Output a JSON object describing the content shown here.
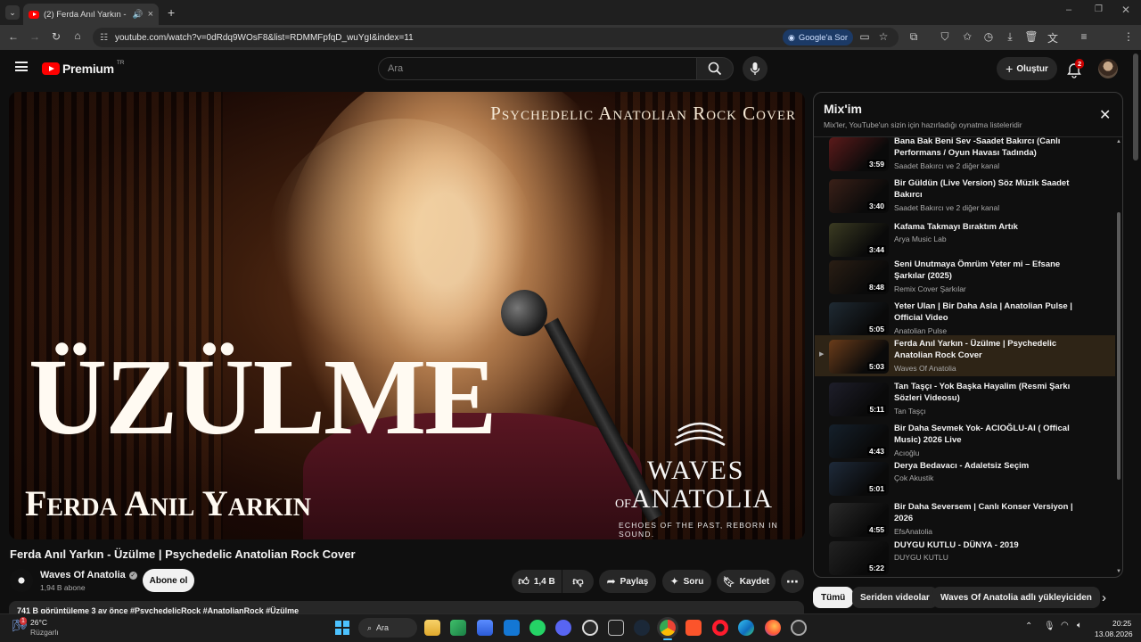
{
  "browser": {
    "tab_title": "(2) Ferda Anıl Yarkın - Üzülme",
    "url": "youtube.com/watch?v=0dRdq9WOsF8&list=RDMMFpfqD_wuYgI&index=11",
    "gemini_label": "Google'a Sor"
  },
  "header": {
    "logo_text": "Premium",
    "logo_region": "TR",
    "search_placeholder": "Ara",
    "create_label": "Oluştur",
    "notification_count": "2"
  },
  "video": {
    "top_text": "Psychedelic Anatolian Rock Cover",
    "big_title": "ÜZÜLME",
    "artist_text": "Ferda Anıl Yarkın",
    "brand_line1": "WAVES",
    "brand_line2_prefix": "OF",
    "brand_line2": "ANATOLIA",
    "brand_tagline": "ECHOES OF THE PAST, REBORN IN SOUND."
  },
  "meta": {
    "title": "Ferda Anıl Yarkın - Üzülme | Psychedelic Anatolian Rock Cover",
    "channel": "Waves Of Anatolia",
    "subscribers": "1,94 B abone",
    "subscribe_label": "Abone ol",
    "likes": "1,4 B",
    "share_label": "Paylaş",
    "ask_label": "Soru",
    "save_label": "Kaydet",
    "description_peek": "741 B görüntüleme  3 ay önce  #PsychedelicRock #AnatolianRock #Üzülme"
  },
  "mix": {
    "title": "Mix'im",
    "subtitle": "Mix'ler, YouTube'un sizin için hazırladığı oynatma listeleridir",
    "items": [
      {
        "title": "Bana Bak Beni Sev -Saadet Bakırcı (Canlı Performans / Oyun Havası Tadında)",
        "channel": "Saadet Bakırcı ve 2 diğer kanal",
        "duration": "3:59"
      },
      {
        "title": "Bir Güldün (Live Version) Söz Müzik Saadet Bakırcı",
        "channel": "Saadet Bakırcı ve 2 diğer kanal",
        "duration": "3:40"
      },
      {
        "title": "Kafama Takmayı Bıraktım Artık",
        "channel": "Arya Music Lab",
        "duration": "3:44"
      },
      {
        "title": "Seni Unutmaya Ömrüm Yeter mi – Efsane Şarkılar (2025)",
        "channel": "Remix Cover Şarkılar",
        "duration": "8:48"
      },
      {
        "title": "Yeter Ulan | Bir Daha Asla | Anatolian Pulse | Official Video",
        "channel": "Anatolian Pulse",
        "duration": "5:05"
      },
      {
        "title": "Ferda Anıl Yarkın - Üzülme | Psychedelic Anatolian Rock Cover",
        "channel": "Waves Of Anatolia",
        "duration": "5:03"
      },
      {
        "title": "Tan Taşçı - Yok Başka Hayalim (Resmi Şarkı Sözleri Videosu)",
        "channel": "Tan Taşçı",
        "duration": "5:11"
      },
      {
        "title": "Bir Daha Sevmek Yok- ACIOĞLU-AI ( Offical Music) 2026 Live",
        "channel": "Acıoğlu",
        "duration": "4:43"
      },
      {
        "title": "Derya Bedavacı - Adaletsiz Seçim",
        "channel": "Çok Akustik",
        "duration": "5:01"
      },
      {
        "title": "Bir Daha Seversem | Canlı Konser Versiyon | 2026",
        "channel": "EfsAnatolia",
        "duration": "4:55"
      },
      {
        "title": "DUYGU KUTLU - DÜNYA - 2019",
        "channel": "DUYGU KUTLU",
        "duration": "5:22"
      }
    ],
    "active_index": 5
  },
  "chips": [
    "Tümü",
    "Seriden videolar",
    "Waves Of Anatolia adlı yükleyiciden"
  ],
  "taskbar": {
    "weather_temp": "26°C",
    "weather_desc": "Rüzgarlı",
    "weather_badge": "1",
    "search_label": "Ara",
    "time": "20:25",
    "date": "13.08.2026"
  },
  "colors": {
    "accent_red": "#ff0000",
    "bg": "#0f0f0f",
    "chip_bg": "#272727",
    "active_row": "#2e2416"
  }
}
